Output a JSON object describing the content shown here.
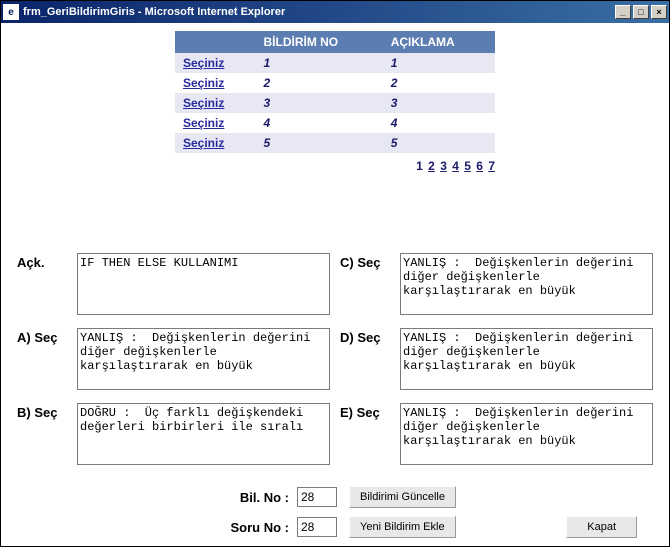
{
  "window": {
    "title": "frm_GeriBildirimGiris - Microsoft Internet Explorer"
  },
  "table": {
    "headers": {
      "col1": "",
      "col2": "BİLDİRİM NO",
      "col3": "AÇIKLAMA"
    },
    "select_label": "Seçiniz",
    "rows": [
      {
        "bildirim_no": "1",
        "aciklama": "1"
      },
      {
        "bildirim_no": "2",
        "aciklama": "2"
      },
      {
        "bildirim_no": "3",
        "aciklama": "3"
      },
      {
        "bildirim_no": "4",
        "aciklama": "4"
      },
      {
        "bildirim_no": "5",
        "aciklama": "5"
      }
    ],
    "pager": {
      "current": "1",
      "pages": [
        "1",
        "2",
        "3",
        "4",
        "5",
        "6",
        "7"
      ]
    }
  },
  "form": {
    "ack_label": "Açk.",
    "ack_value": "IF THEN ELSE KULLANIMI",
    "a_label": "A) Seç",
    "a_value": "YANLIŞ :  Değişkenlerin değerini diğer değişkenlerle karşılaştırarak en büyük",
    "b_label": "B) Seç",
    "b_value": "DOĞRU :  Üç farklı değişkendeki değerleri birbirleri ile sıralı",
    "c_label": "C) Seç",
    "c_value": "YANLIŞ :  Değişkenlerin değerini diğer değişkenlerle karşılaştırarak en büyük",
    "d_label": "D) Seç",
    "d_value": "YANLIŞ :  Değişkenlerin değerini diğer değişkenlerle karşılaştırarak en büyük",
    "e_label": "E) Seç",
    "e_value": "YANLIŞ :  Değişkenlerin değerini diğer değişkenlerle karşılaştırarak en büyük"
  },
  "bottom": {
    "bil_no_label": "Bil. No :",
    "bil_no_value": "28",
    "soru_no_label": "Soru No :",
    "soru_no_value": "28",
    "btn_guncelle": "Bildirimi Güncelle",
    "btn_ekle": "Yeni Bildirim Ekle",
    "btn_kapat": "Kapat"
  }
}
